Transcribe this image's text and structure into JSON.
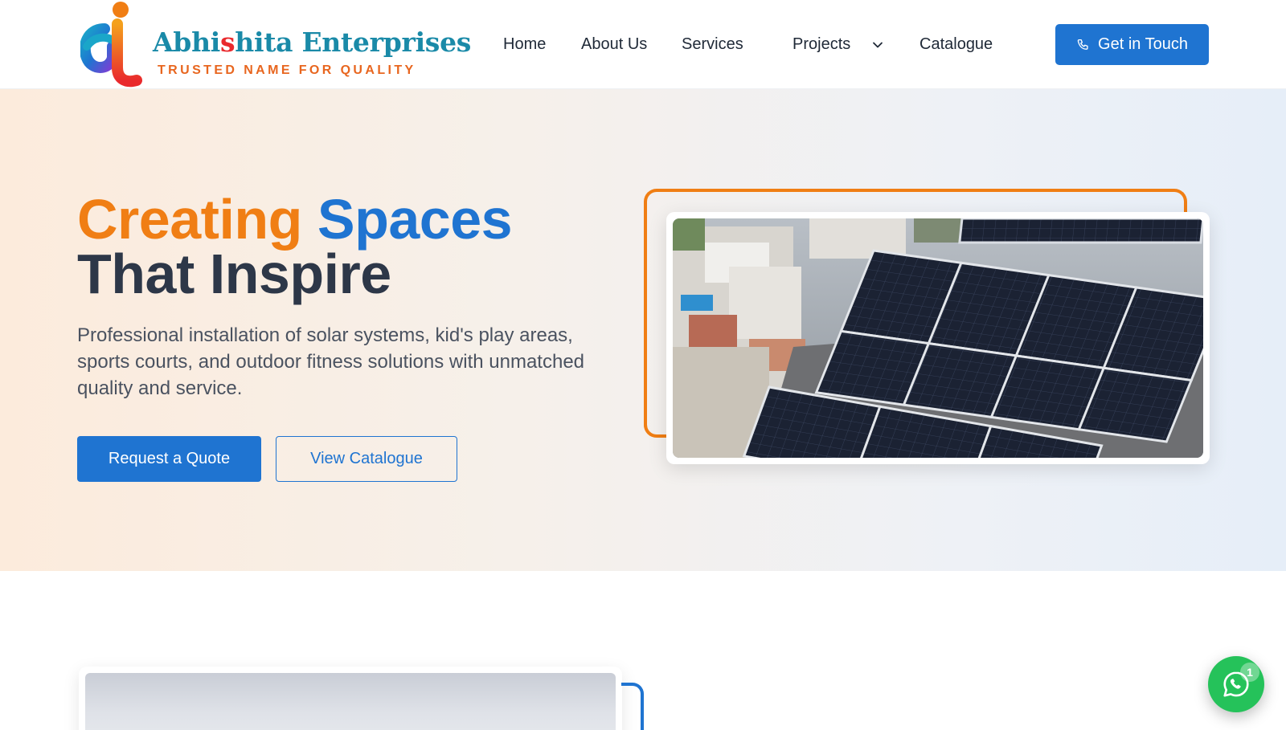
{
  "brand": {
    "name_part1": "Abhi",
    "name_highlight": "s",
    "name_part2": "hita Enterprises",
    "tagline": "TRUSTED NAME FOR QUALITY",
    "colors": {
      "primary_blue": "#1f74d1",
      "accent_orange": "#f07e14",
      "logo_teal": "#1a8aa8",
      "logo_red": "#e9292d"
    }
  },
  "nav": {
    "items": [
      {
        "label": "Home"
      },
      {
        "label": "About Us"
      },
      {
        "label": "Services"
      },
      {
        "label": "Projects"
      },
      {
        "label": "Catalogue"
      }
    ],
    "dropdown_icon": "chevron-down-icon",
    "cta_label": "Get in Touch",
    "cta_icon": "phone-icon"
  },
  "hero": {
    "headline_word1": "Creating",
    "headline_word2": "Spaces",
    "headline_line2": "That Inspire",
    "lead": "Professional installation of solar systems, kid's play areas, sports courts, and outdoor fitness solutions with unmatched quality and service.",
    "primary_button": "Request a Quote",
    "secondary_button": "View Catalogue",
    "image_subject": "rooftop solar panels"
  },
  "whatsapp": {
    "icon": "whatsapp-icon",
    "badge_count": "1"
  }
}
